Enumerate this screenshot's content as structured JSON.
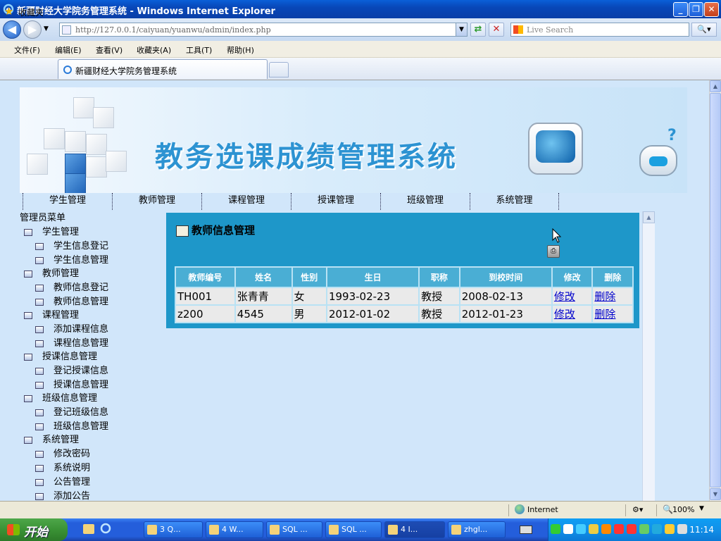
{
  "window": {
    "title": "新疆财经大学院务管理系统 - Windows Internet Explorer"
  },
  "address": {
    "url": "http://127.0.0.1/caiyuan/yuanwu/admin/index.php"
  },
  "search": {
    "placeholder": "Live Search"
  },
  "menu": {
    "items": [
      "文件(F)",
      "编辑(E)",
      "查看(V)",
      "收藏夹(A)",
      "工具(T)",
      "帮助(H)"
    ]
  },
  "favorites": {
    "label": "收藏夹"
  },
  "tab": {
    "title": "新疆财经大学院务管理系统"
  },
  "banner": {
    "title": "教务选课成绩管理系统"
  },
  "top_nav": [
    "学生管理",
    "教师管理",
    "课程管理",
    "授课管理",
    "班级管理",
    "系统管理"
  ],
  "left_menu": {
    "root": "管理员菜单",
    "groups": [
      {
        "label": "学生管理",
        "items": [
          "学生信息登记",
          "学生信息管理"
        ]
      },
      {
        "label": "教师管理",
        "items": [
          "教师信息登记",
          "教师信息管理"
        ]
      },
      {
        "label": "课程管理",
        "items": [
          "添加课程信息",
          "课程信息管理"
        ]
      },
      {
        "label": "授课信息管理",
        "items": [
          "登记授课信息",
          "授课信息管理"
        ]
      },
      {
        "label": "班级信息管理",
        "items": [
          "登记班级信息",
          "班级信息管理"
        ]
      },
      {
        "label": "系统管理",
        "items": [
          "修改密码",
          "系统说明",
          "公告管理",
          "添加公告"
        ]
      }
    ]
  },
  "panel": {
    "title": "教师信息管理",
    "columns": [
      "教师编号",
      "姓名",
      "性别",
      "生日",
      "职称",
      "到校时间",
      "修改",
      "删除"
    ],
    "rows": [
      [
        "TH001",
        "张青青",
        "女",
        "1993-02-23",
        "教授",
        "2008-02-13",
        "修改",
        "删除"
      ],
      [
        "z200",
        "4545",
        "男",
        "2012-01-02",
        "教授",
        "2012-01-23",
        "修改",
        "删除"
      ]
    ]
  },
  "status": {
    "zone": "Internet",
    "zoom": "100%"
  },
  "taskbar": {
    "start": "开始",
    "buttons": [
      "3 Q...",
      "4 W...",
      "SQL ...",
      "SQL ...",
      "4 I...",
      "zhgl..."
    ],
    "clock": "11:14"
  },
  "colors": {
    "panel_bg": "#1e97c9",
    "table_header": "#4aaed4",
    "content_bg": "#d1e6fa",
    "banner_title": "#2d93d2"
  }
}
